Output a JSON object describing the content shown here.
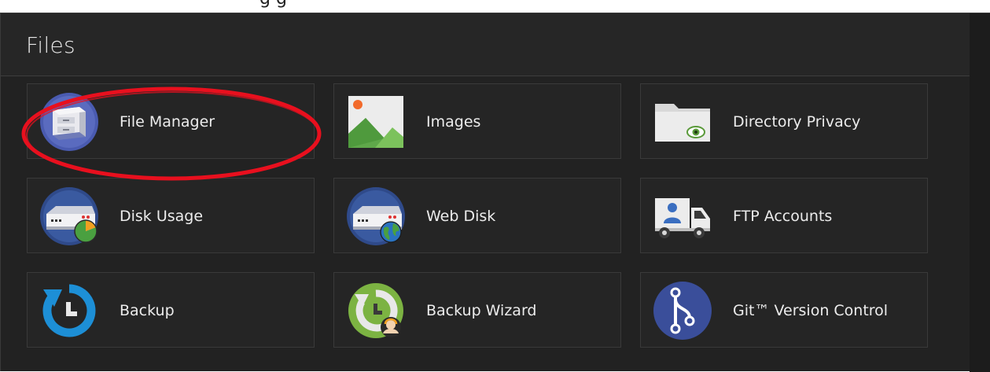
{
  "section": {
    "title": "Files"
  },
  "top_strip_text": "g                                          g",
  "tiles": [
    {
      "label": "File Manager",
      "icon": "file-manager-icon"
    },
    {
      "label": "Images",
      "icon": "images-icon"
    },
    {
      "label": "Directory Privacy",
      "icon": "directory-privacy-icon"
    },
    {
      "label": "Disk Usage",
      "icon": "disk-usage-icon"
    },
    {
      "label": "Web Disk",
      "icon": "web-disk-icon"
    },
    {
      "label": "FTP Accounts",
      "icon": "ftp-accounts-icon"
    },
    {
      "label": "Backup",
      "icon": "backup-icon"
    },
    {
      "label": "Backup Wizard",
      "icon": "backup-wizard-icon"
    },
    {
      "label": "Git™ Version Control",
      "icon": "git-version-control-icon"
    }
  ],
  "colors": {
    "panel_bg": "#222222",
    "tile_border": "#3a3a3a",
    "text": "#ececec",
    "highlight": "#e8101e"
  }
}
